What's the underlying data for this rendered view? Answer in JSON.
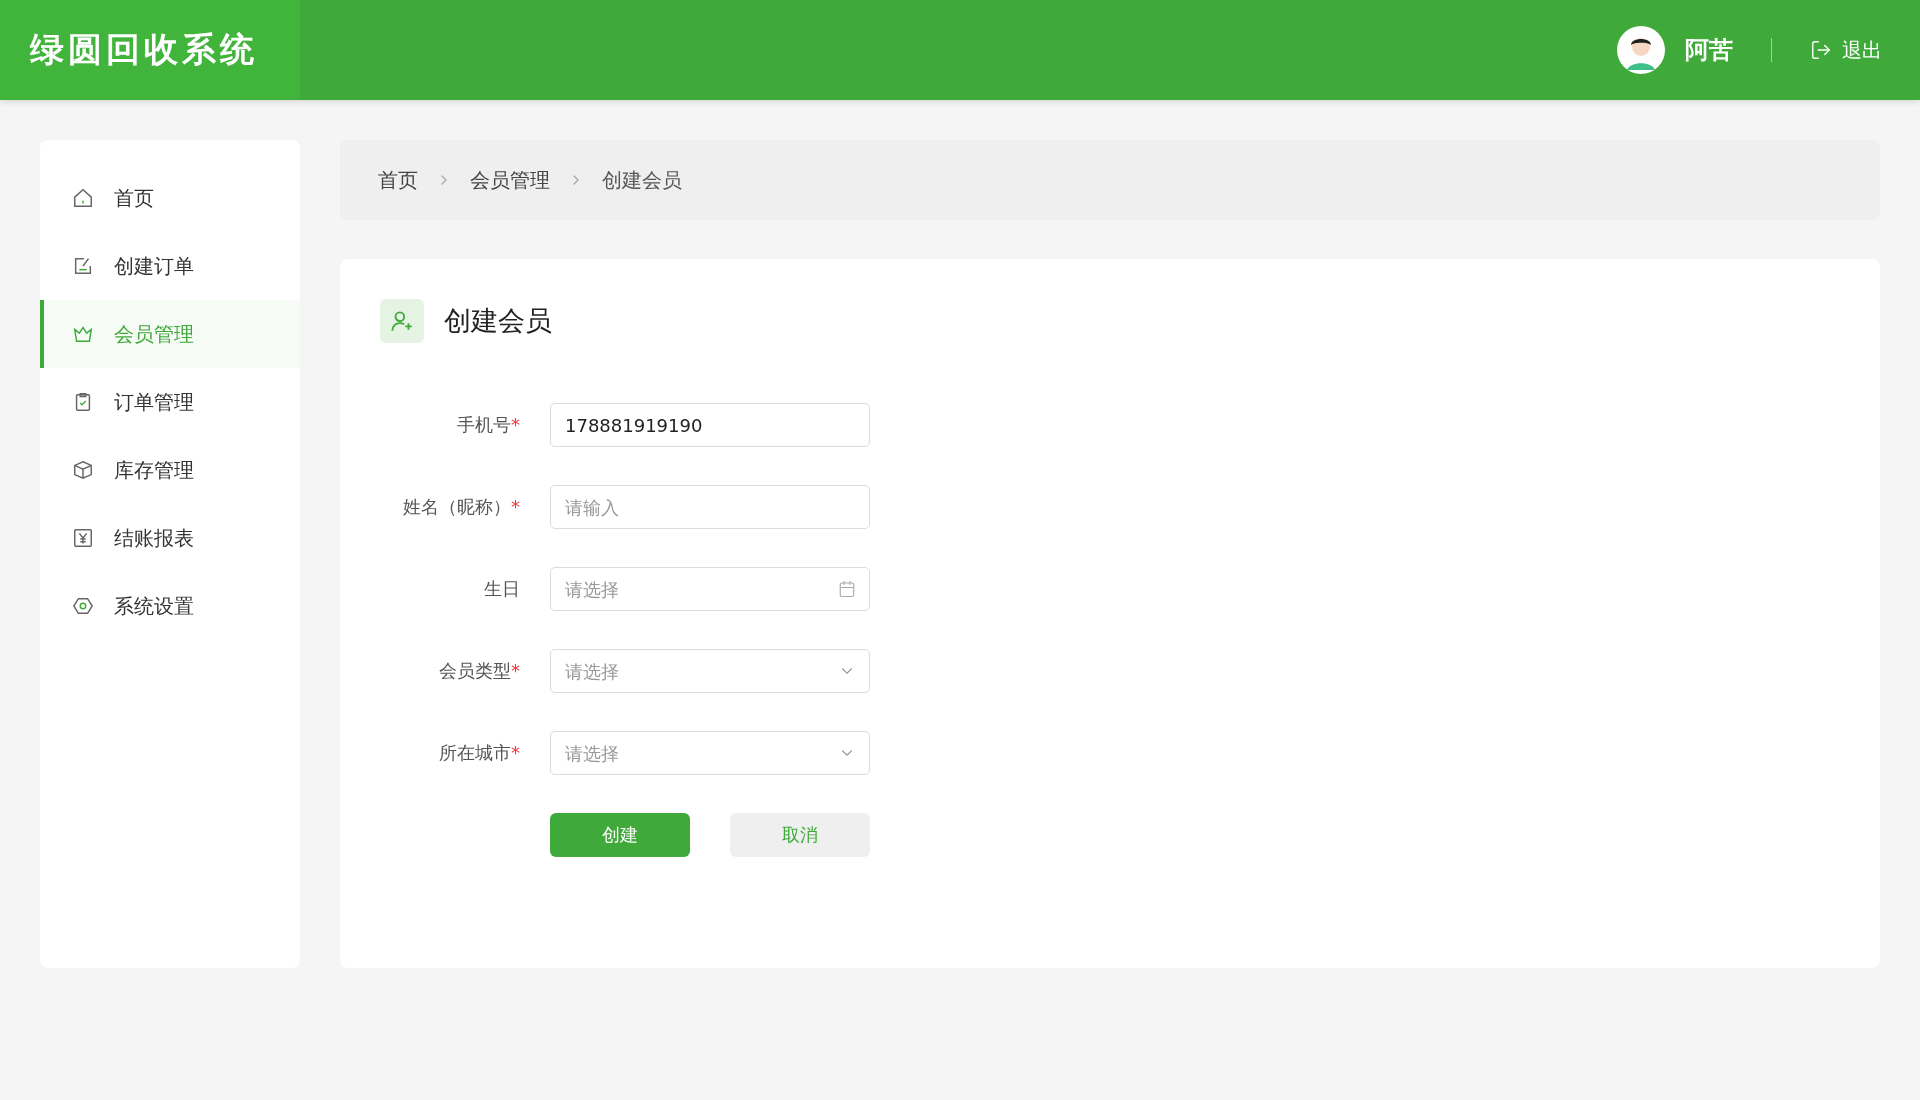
{
  "header": {
    "logo": "绿圆回收系统",
    "user": "阿苦",
    "logout": "退出"
  },
  "sidebar": {
    "items": [
      {
        "label": "首页",
        "selected": false
      },
      {
        "label": "创建订单",
        "selected": false
      },
      {
        "label": "会员管理",
        "selected": true
      },
      {
        "label": "订单管理",
        "selected": false
      },
      {
        "label": "库存管理",
        "selected": false
      },
      {
        "label": "结账报表",
        "selected": false
      },
      {
        "label": "系统设置",
        "selected": false
      }
    ]
  },
  "breadcrumb": [
    "首页",
    "会员管理",
    "创建会员"
  ],
  "form": {
    "title": "创建会员",
    "fields": [
      {
        "label": "手机号",
        "required_mark": "*",
        "kind": "text",
        "value": "178881919190"
      },
      {
        "label": "姓名（昵称）",
        "required_mark": "*",
        "kind": "text",
        "placeholder": "请输入"
      },
      {
        "label": "生日",
        "kind": "date",
        "placeholder": "请选择"
      },
      {
        "label": "会员类型",
        "required_mark": "*",
        "kind": "select",
        "placeholder": "请选择"
      },
      {
        "label": "所在城市",
        "required_mark": "*",
        "kind": "select",
        "placeholder": "请选择"
      }
    ],
    "buttons": [
      {
        "label": "创建",
        "kind": "primary"
      },
      {
        "label": "取消",
        "kind": "secondary"
      }
    ]
  }
}
